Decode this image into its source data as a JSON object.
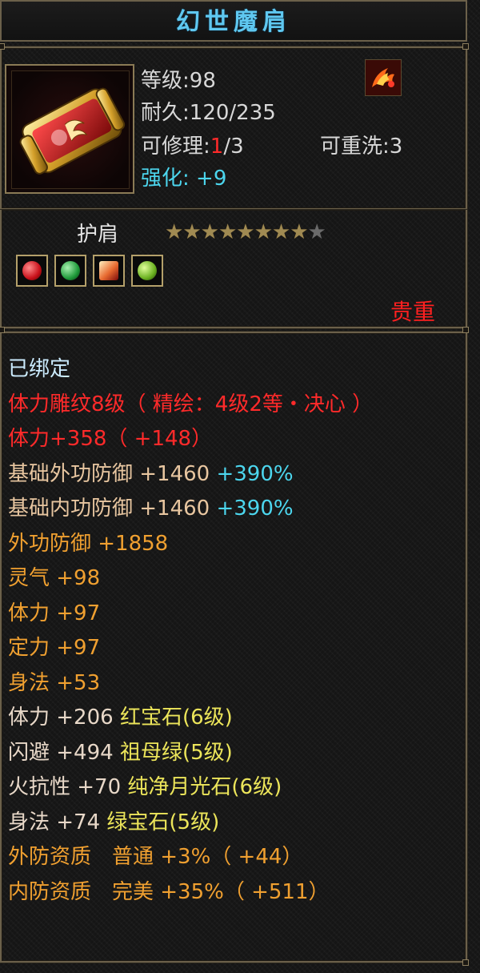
{
  "item": {
    "name": "幻世魔肩",
    "level_label": "等级",
    "level_sep": ":",
    "level_value": "98",
    "durability_label": "耐久",
    "durability_sep": ":",
    "durability_value": "120/235",
    "repair_label": "可修理",
    "repair_sep": ":",
    "repair_current": "1",
    "repair_max": "/3",
    "rewash_label": "可重洗",
    "rewash_sep": ":",
    "rewash_value": "3",
    "enhance_label": "强化:",
    "enhance_value": "+9",
    "slot": "护肩",
    "stars_filled": 8,
    "stars_total": 9,
    "rarity": "贵重",
    "icon": "golden-shoulder-scroll-icon",
    "element_icon": "fire-swirl-icon",
    "gems": [
      {
        "icon": "ruby-gem-icon",
        "color": "#c8101a"
      },
      {
        "icon": "emerald-gem-icon",
        "color": "#1f9a3a"
      },
      {
        "icon": "fire-crystal-gem-icon",
        "color": "#e86a30"
      },
      {
        "icon": "green-jade-gem-icon",
        "color": "#6ab020"
      }
    ]
  },
  "attributes": [
    {
      "color": "c-white",
      "parts": [
        "已绑定"
      ]
    },
    {
      "color": "c-red",
      "parts": [
        "体力雕纹8级（ 精绘：4级2等・决心 ）"
      ]
    },
    {
      "color": "c-red",
      "parts": [
        "体力+358（ +148）"
      ]
    },
    {
      "color": "c-tan",
      "parts": [
        "基础外功防御 +1460 ",
        "+390%"
      ],
      "accent": "c-cyan"
    },
    {
      "color": "c-tan",
      "parts": [
        "基础内功防御 +1460 ",
        "+390%"
      ],
      "accent": "c-cyan"
    },
    {
      "color": "c-orange",
      "parts": [
        "外功防御 +1858"
      ]
    },
    {
      "color": "c-orange",
      "parts": [
        "灵气 +98"
      ]
    },
    {
      "color": "c-orange",
      "parts": [
        "体力 +97"
      ]
    },
    {
      "color": "c-orange",
      "parts": [
        "定力 +97"
      ]
    },
    {
      "color": "c-orange",
      "parts": [
        "身法 +53"
      ]
    },
    {
      "color": "c-light",
      "parts": [
        "体力 +206 ",
        "红宝石(6级)"
      ],
      "accent": "c-yellow"
    },
    {
      "color": "c-light",
      "parts": [
        "闪避 +494 ",
        "祖母绿(5级)"
      ],
      "accent": "c-yellow"
    },
    {
      "color": "c-light",
      "parts": [
        "火抗性 +70 ",
        "纯净月光石(6级)"
      ],
      "accent": "c-yellow"
    },
    {
      "color": "c-light",
      "parts": [
        "身法 +74 ",
        "绿宝石(5级)"
      ],
      "accent": "c-yellow"
    },
    {
      "color": "c-orange",
      "parts": [
        "外防资质　普通 +3%（ +44）"
      ]
    },
    {
      "color": "c-orange",
      "parts": [
        "内防资质　完美 +35%（ +511）"
      ]
    }
  ]
}
